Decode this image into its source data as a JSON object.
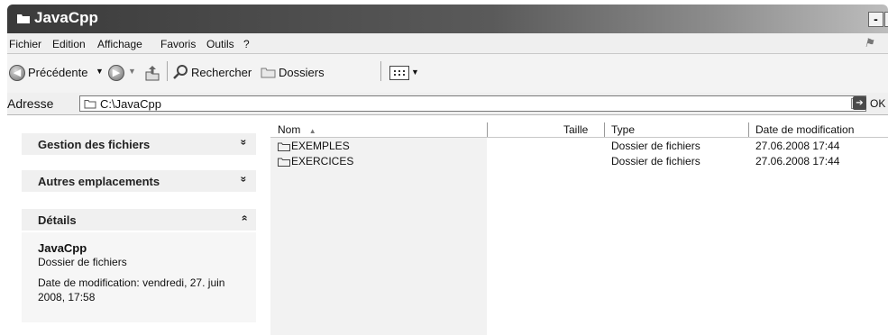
{
  "window": {
    "title": "JavaCpp",
    "min_glyph": "-",
    "max_glyph": "□",
    "close_glyph": "×"
  },
  "menu": [
    "Fichier",
    "Edition",
    "Affichage",
    "Favoris",
    "Outils",
    "?"
  ],
  "toolbar": {
    "back_label": "Précédente",
    "search_label": "Rechercher",
    "folders_label": "Dossiers"
  },
  "address": {
    "label": "Adresse",
    "value": "C:\\JavaCpp",
    "go_label": "OK"
  },
  "tasks": {
    "file_tasks": "Gestion des fichiers",
    "other_places": "Autres emplacements",
    "details": "Détails",
    "collapse_glyph": "»",
    "expand_glyph": "«"
  },
  "details": {
    "name": "JavaCpp",
    "type": "Dossier de fichiers",
    "modified": "Date de modification: vendredi, 27. juin 2008, 17:58"
  },
  "columns": {
    "name": "Nom",
    "size": "Taille",
    "type": "Type",
    "date": "Date de modification"
  },
  "files": [
    {
      "name": "EXEMPLES",
      "type": "Dossier de fichiers",
      "date": "27.06.2008 17:44"
    },
    {
      "name": "EXERCICES",
      "type": "Dossier de fichiers",
      "date": "27.06.2008 17:44"
    }
  ],
  "colors": {
    "titlebar": "#4a4a4a",
    "pane_header": "#f0f0f0"
  }
}
